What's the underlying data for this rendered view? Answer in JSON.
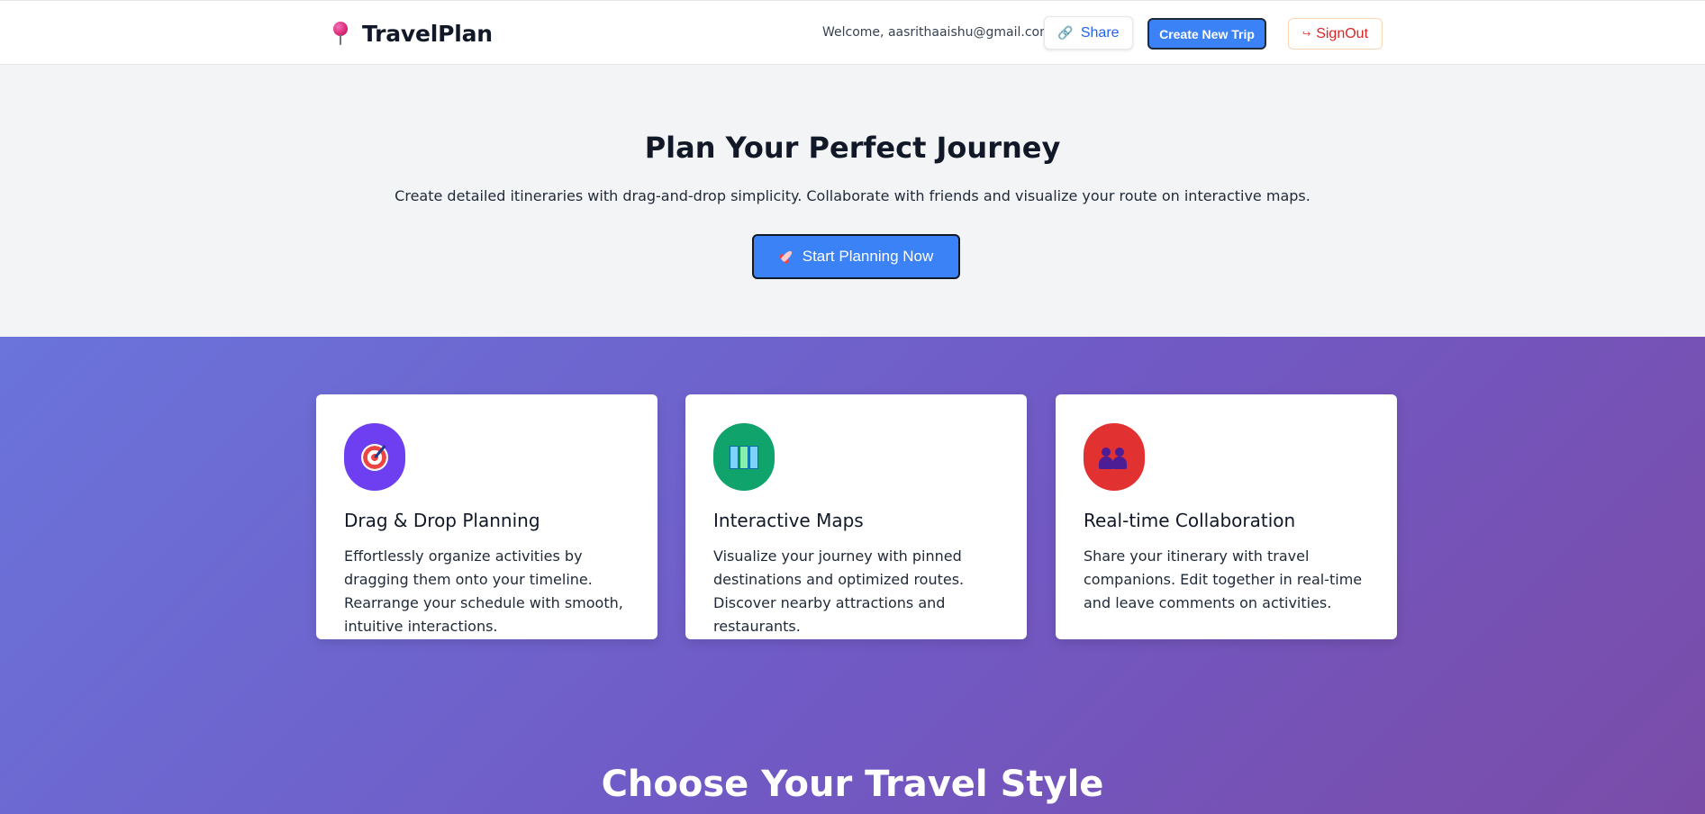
{
  "header": {
    "brand": "TravelPlan",
    "welcome": "Welcome, aasrithaaishu@gmail.com",
    "share_label": "Share",
    "create_label": "Create New Trip",
    "signout_label": "SignOut"
  },
  "hero": {
    "title": "Plan Your Perfect Journey",
    "subtitle": "Create detailed itineraries with drag-and-drop simplicity. Collaborate with friends and visualize your route on interactive maps.",
    "cta_label": "Start Planning Now"
  },
  "features": [
    {
      "icon": "target-icon",
      "title": "Drag & Drop Planning",
      "description": "Effortlessly organize activities by dragging them onto your timeline. Rearrange your schedule with smooth, intuitive interactions."
    },
    {
      "icon": "map-icon",
      "title": "Interactive Maps",
      "description": "Visualize your journey with pinned destinations and optimized routes. Discover nearby attractions and restaurants."
    },
    {
      "icon": "people-icon",
      "title": "Real-time Collaboration",
      "description": "Share your itinerary with travel companions. Edit together in real-time and leave comments on activities."
    }
  ],
  "travel_style": {
    "title": "Choose Your Travel Style"
  },
  "colors": {
    "primary": "#3b82f6",
    "danger": "#dc2626",
    "gradient_start": "#6a74db",
    "gradient_end": "#7a4ca8",
    "icon_purple": "#6d3ff0",
    "icon_green": "#10a36b",
    "icon_red": "#e23131"
  }
}
